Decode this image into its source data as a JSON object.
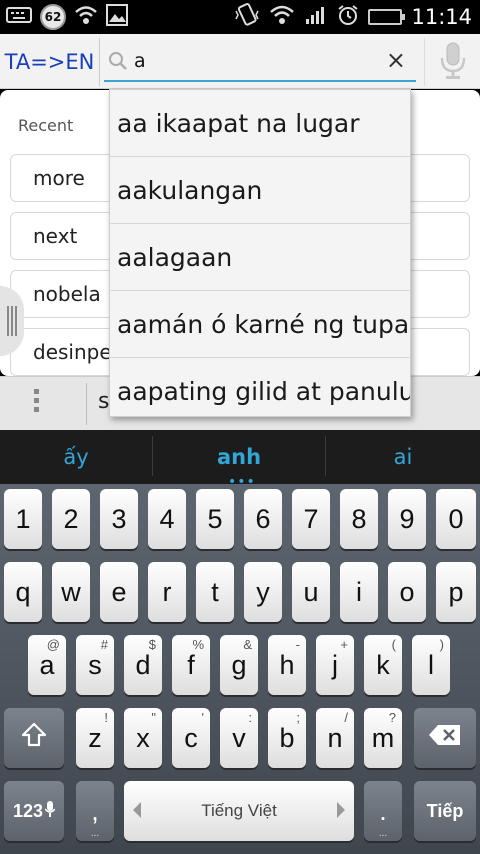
{
  "status_bar": {
    "notification_count": "62",
    "time": "11:14",
    "icons": [
      "keyboard-icon",
      "wifi-icon",
      "image-icon",
      "vibrate-icon",
      "wifi-icon",
      "signal-icon",
      "alarm-icon",
      "battery-icon"
    ]
  },
  "header": {
    "language_pair": "TA=>EN",
    "search_value": "a",
    "clear_label": "×"
  },
  "content": {
    "recent_label": "Recent",
    "recent_items": [
      "more",
      "next",
      "nobela",
      "desinpe"
    ],
    "bottom_text": "s"
  },
  "suggestions": [
    "aa ikaapat na lugar",
    "aakulangan",
    "aalagaan",
    "aamán ó karné ng tupa",
    "aapating gilid at panulu"
  ],
  "candidates": [
    "ấy",
    "anh",
    "ai"
  ],
  "keyboard": {
    "numbers": [
      "1",
      "2",
      "3",
      "4",
      "5",
      "6",
      "7",
      "8",
      "9",
      "0"
    ],
    "row1": [
      "q",
      "w",
      "e",
      "r",
      "t",
      "y",
      "u",
      "i",
      "o",
      "p"
    ],
    "row2": [
      {
        "k": "a",
        "s": "@"
      },
      {
        "k": "s",
        "s": "#"
      },
      {
        "k": "d",
        "s": "$"
      },
      {
        "k": "f",
        "s": "%"
      },
      {
        "k": "g",
        "s": "&"
      },
      {
        "k": "h",
        "s": "-"
      },
      {
        "k": "j",
        "s": "+"
      },
      {
        "k": "k",
        "s": "("
      },
      {
        "k": "l",
        "s": ")"
      }
    ],
    "row3": [
      {
        "k": "z",
        "s": "!"
      },
      {
        "k": "x",
        "s": "\""
      },
      {
        "k": "c",
        "s": "'"
      },
      {
        "k": "v",
        "s": ":"
      },
      {
        "k": "b",
        "s": ";"
      },
      {
        "k": "n",
        "s": "/"
      },
      {
        "k": "m",
        "s": "?"
      }
    ],
    "mode_label": "123",
    "comma": ",",
    "space_label": "Tiếng Việt",
    "period": ".",
    "enter_label": "Tiếp"
  },
  "colors": {
    "accent": "#33a6d8",
    "language": "#1a3fb8"
  }
}
